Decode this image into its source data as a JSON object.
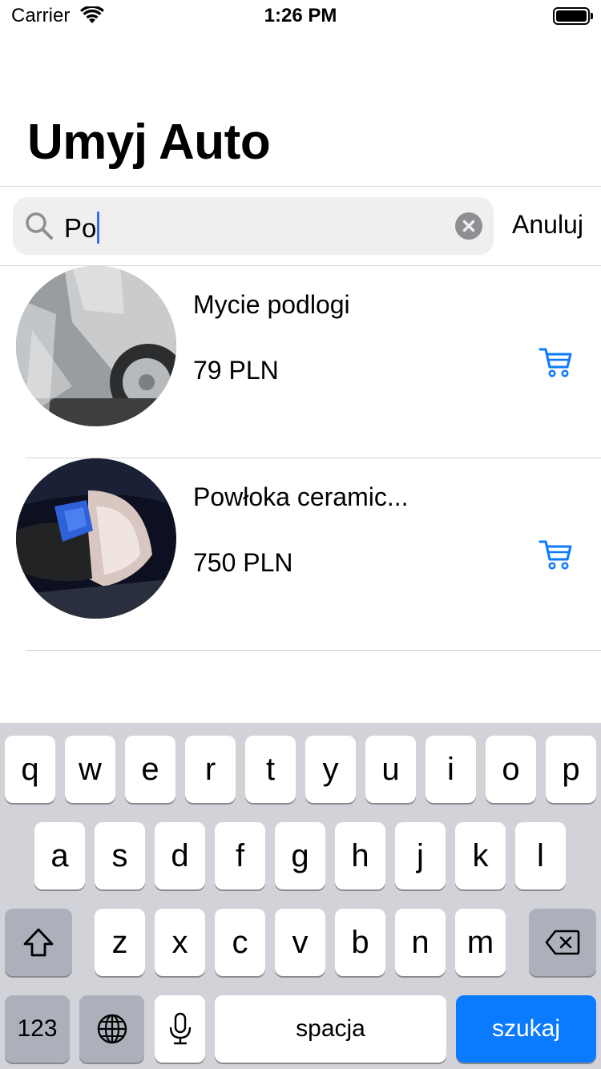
{
  "status_bar": {
    "carrier": "Carrier",
    "time": "1:26 PM"
  },
  "header": {
    "title": "Umyj Auto"
  },
  "search": {
    "value": "Po",
    "cancel_label": "Anuluj"
  },
  "results": [
    {
      "title": "Mycie podlogi",
      "price": "79 PLN"
    },
    {
      "title": "Powłoka ceramic...",
      "price": "750 PLN"
    }
  ],
  "keyboard": {
    "row1": [
      "q",
      "w",
      "e",
      "r",
      "t",
      "y",
      "u",
      "i",
      "o",
      "p"
    ],
    "row2": [
      "a",
      "s",
      "d",
      "f",
      "g",
      "h",
      "j",
      "k",
      "l"
    ],
    "row3": [
      "z",
      "x",
      "c",
      "v",
      "b",
      "n",
      "m"
    ],
    "numbers_label": "123",
    "space_label": "spacja",
    "action_label": "szukaj"
  },
  "colors": {
    "accent": "#0a7aff",
    "cursor": "#3a6bff",
    "keyboard_bg": "#d1d3d9"
  }
}
